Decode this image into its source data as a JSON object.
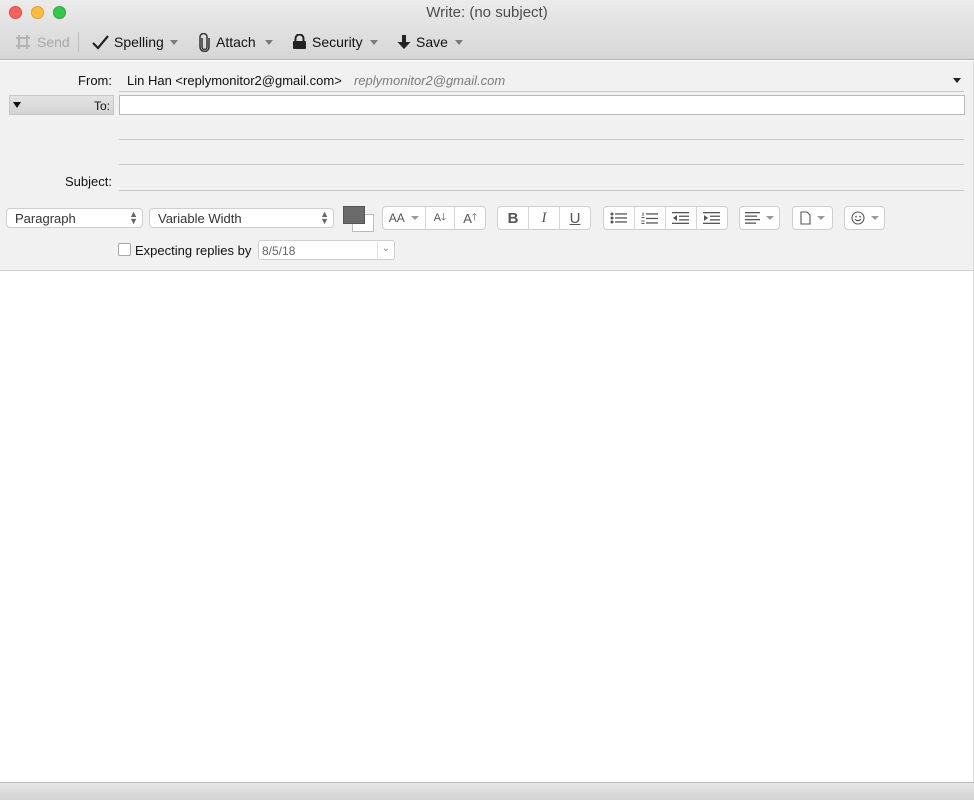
{
  "window": {
    "title": "Write: (no subject)",
    "traffic_lights": [
      "close",
      "minimize",
      "zoom"
    ]
  },
  "toolbar": {
    "send_label": "Send",
    "spelling_label": "Spelling",
    "attach_label": "Attach",
    "security_label": "Security",
    "save_label": "Save"
  },
  "header": {
    "from_label": "From:",
    "from_value": "Lin Han <replymonitor2@gmail.com>",
    "from_email_hint": "replymonitor2@gmail.com",
    "to_label": "To:",
    "to_value": "",
    "subject_label": "Subject:",
    "subject_value": ""
  },
  "format_bar": {
    "paragraph_select": "Paragraph",
    "font_select": "Variable Width",
    "text_color": "#6b6b6b",
    "background_color": "#ffffff",
    "font_size_label": "AA",
    "smaller_label": "A",
    "larger_label": "A",
    "bold_label": "B",
    "italic_label": "I",
    "underline_label": "U",
    "icons": [
      "bulleted-list-icon",
      "numbered-list-icon",
      "outdent-icon",
      "indent-icon",
      "align-icon",
      "insert-icon",
      "smiley-icon"
    ]
  },
  "replies": {
    "checkbox_label": "Expecting replies by",
    "checked": false,
    "date": "8/5/18"
  },
  "body": {
    "text": ""
  }
}
